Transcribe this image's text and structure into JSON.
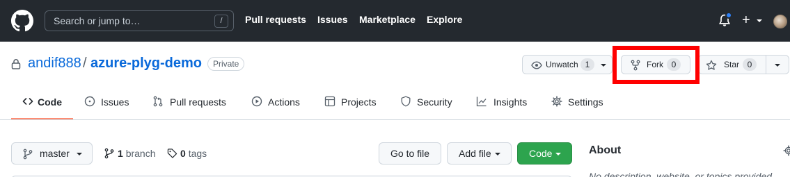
{
  "header": {
    "search_placeholder": "Search or jump to…",
    "search_shortcut": "/",
    "nav": [
      "Pull requests",
      "Issues",
      "Marketplace",
      "Explore"
    ],
    "plus_label": "+"
  },
  "repo": {
    "owner": "andif888",
    "separator": "/",
    "name": "azure-plyg-demo",
    "visibility": "Private",
    "watch": {
      "label": "Unwatch",
      "count": "1"
    },
    "fork": {
      "label": "Fork",
      "count": "0"
    },
    "star": {
      "label": "Star",
      "count": "0"
    }
  },
  "tabs": [
    {
      "label": "Code",
      "icon": "code-icon",
      "selected": true
    },
    {
      "label": "Issues",
      "icon": "issue-opened-icon"
    },
    {
      "label": "Pull requests",
      "icon": "git-pull-request-icon"
    },
    {
      "label": "Actions",
      "icon": "play-icon"
    },
    {
      "label": "Projects",
      "icon": "table-icon"
    },
    {
      "label": "Security",
      "icon": "shield-icon"
    },
    {
      "label": "Insights",
      "icon": "graph-icon"
    },
    {
      "label": "Settings",
      "icon": "gear-icon"
    }
  ],
  "toolbar": {
    "branch_selector": "master",
    "branch_count": "1",
    "branch_word": "branch",
    "tag_count": "0",
    "tag_word": "tags",
    "goto_file": "Go to file",
    "add_file": "Add file",
    "code": "Code"
  },
  "about": {
    "title": "About",
    "description": "No description, website, or topics provided."
  },
  "colors": {
    "header_bg": "#24292f",
    "link": "#0969da",
    "code_button": "#2da44e",
    "tab_underline": "#fd8c73",
    "annotation": "#ff0000"
  }
}
